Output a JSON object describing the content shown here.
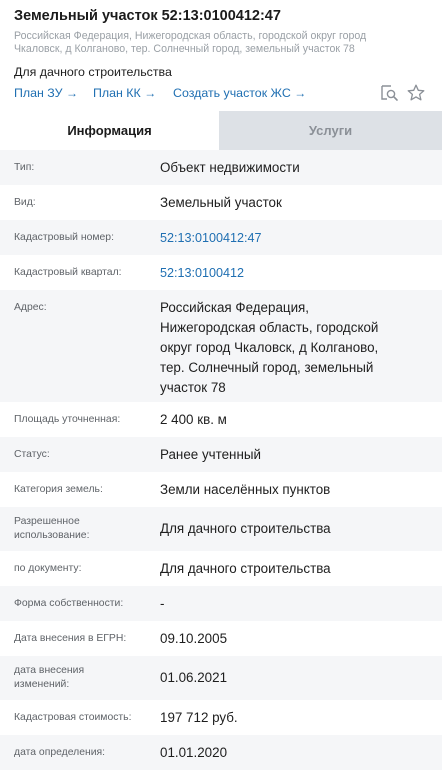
{
  "header": {
    "title": "Земельный участок 52:13:0100412:47",
    "subtitle_line1": "Российская Федерация, Нижегородская область, городской округ город",
    "subtitle_line2": "Чкаловск, д Колганово, тер. Солнечный город, земельный участок 78",
    "purpose": "Для дачного строительства",
    "links": {
      "plan_zu": "План ЗУ",
      "plan_kk": "План КК",
      "create_zs": "Создать участок ЖС",
      "arrow": "→"
    }
  },
  "tabs": {
    "info": "Информация",
    "services": "Услуги"
  },
  "rows": {
    "type": {
      "label": "Тип:",
      "value": "Объект недвижимости"
    },
    "kind": {
      "label": "Вид:",
      "value": "Земельный участок"
    },
    "cad_number": {
      "label": "Кадастровый номер:",
      "value": "52:13:0100412:47"
    },
    "cad_quarter": {
      "label": "Кадастровый квартал:",
      "value": "52:13:0100412"
    },
    "address": {
      "label": "Адрес:",
      "line1": "Российская Федерация,",
      "line2": "Нижегородская область, городской",
      "line3": "округ город Чкаловск, д Колганово,",
      "line4": "тер. Солнечный город, земельный",
      "line5": "участок 78"
    },
    "area": {
      "label": "Площадь уточненная:",
      "value": "2 400 кв. м"
    },
    "status": {
      "label": "Статус:",
      "value": "Ранее учтенный"
    },
    "category": {
      "label": "Категория земель:",
      "value": "Земли населённых пунктов"
    },
    "permitted_use": {
      "label_line1": "Разрешенное",
      "label_line2": "использование:",
      "value": "Для дачного строительства"
    },
    "by_document": {
      "label": "по документу:",
      "value": "Для дачного строительства"
    },
    "ownership": {
      "label": "Форма собственности:",
      "value": "-"
    },
    "egrn_date": {
      "label": "Дата внесения в ЕГРН:",
      "value": "09.10.2005"
    },
    "change_date": {
      "label_line1": "дата внесения",
      "label_line2": "изменений:",
      "value": "01.06.2021"
    },
    "cad_cost": {
      "label": "Кадастровая стоимость:",
      "value": "197 712 руб."
    },
    "determination_date": {
      "label": "дата определения:",
      "value": "01.01.2020"
    }
  },
  "colors": {
    "link": "#1f6fb2",
    "label": "#5f6368",
    "subtitle": "#9aa0a6",
    "tab_inactive_bg": "#dde1e6",
    "row_alt_bg": "#f5f6f8"
  },
  "icons": [
    "search-map-icon",
    "star-icon"
  ]
}
